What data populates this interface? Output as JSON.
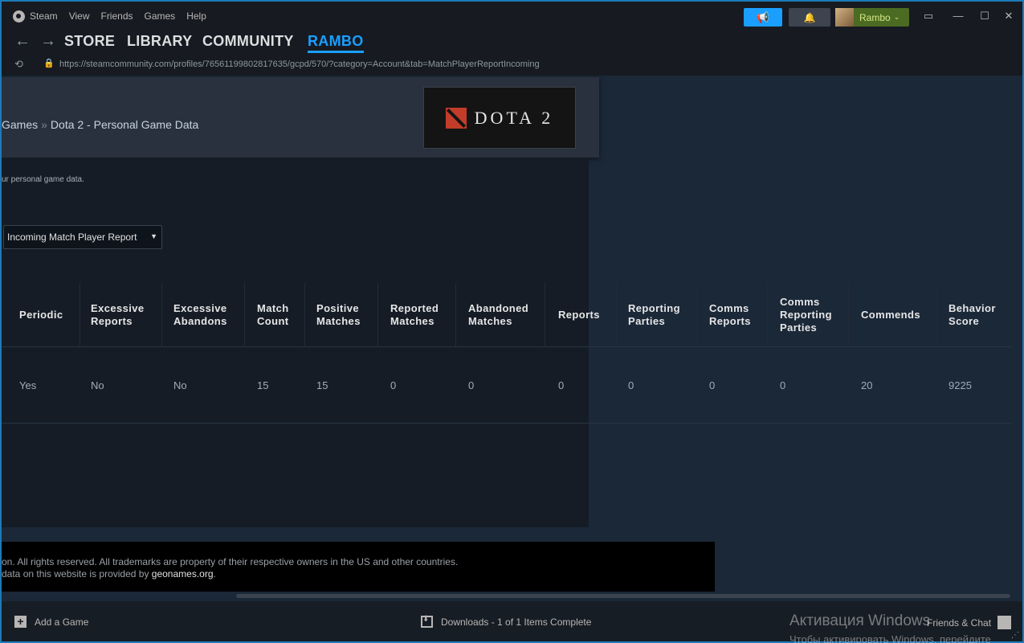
{
  "menubar": {
    "app_name": "Steam",
    "items": [
      "View",
      "Friends",
      "Games",
      "Help"
    ],
    "user_name": "Rambo"
  },
  "nav": {
    "tabs": [
      "STORE",
      "LIBRARY",
      "COMMUNITY",
      "RAMBO"
    ],
    "active_tab": "RAMBO"
  },
  "url": "https://steamcommunity.com/profiles/76561199802817635/gcpd/570/?category=Account&tab=MatchPlayerReportIncoming",
  "page": {
    "breadcrumb_games": "Games",
    "breadcrumb_sep": "»",
    "breadcrumb_current": "Dota 2 - Personal Game Data",
    "game_logo_text": "DOTA 2",
    "description": "ur personal game data.",
    "select_value": "Incoming Match Player Report"
  },
  "table": {
    "headers": [
      "Periodic",
      "Excessive Reports",
      "Excessive Abandons",
      "Match Count",
      "Positive Matches",
      "Reported Matches",
      "Abandoned Matches",
      "Reports",
      "Reporting Parties",
      "Comms Reports",
      "Comms Reporting Parties",
      "Commends",
      "Behavior Score"
    ],
    "rows": [
      [
        "Yes",
        "No",
        "No",
        "15",
        "15",
        "0",
        "0",
        "0",
        "0",
        "0",
        "0",
        "20",
        "9225"
      ]
    ]
  },
  "footer": {
    "line1": "on. All rights reserved. All trademarks are property of their respective owners in the US and other countries.",
    "line2_prefix": "data on this website is provided by ",
    "line2_link": "geonames.org",
    "line2_suffix": "."
  },
  "bottombar": {
    "add_game": "Add a Game",
    "downloads": "Downloads - 1 of 1 Items Complete",
    "friends": "Friends & Chat"
  },
  "watermark": {
    "title": "Активация Windows",
    "subtitle": "Чтобы активировать Windows, перейдите"
  },
  "colors": {
    "accent": "#1a9fff",
    "user_green": "#4c6b22",
    "background": "#1b2838"
  }
}
